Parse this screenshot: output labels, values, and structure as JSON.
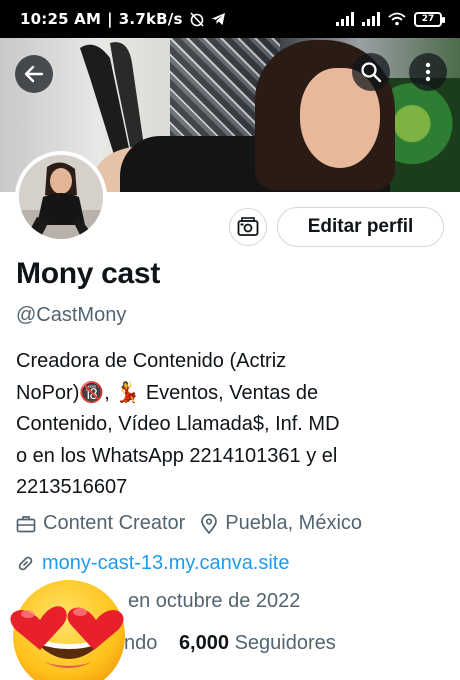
{
  "status_bar": {
    "time": "10:25 AM",
    "net_speed": "3.7kB/s",
    "battery": "27"
  },
  "header": {
    "back_icon": "back-arrow-icon",
    "search_icon": "search-icon",
    "more_icon": "more-vertical-icon"
  },
  "profile": {
    "display_name": "Mony cast",
    "handle": "@CastMony",
    "bio_lines": [
      "Creadora de Contenido (Actriz",
      "NoPor)🔞, 💃 Eventos, Ventas de",
      "Contenido,  Vídeo Llamada$, Inf. MD",
      "o en los WhatsApp  2214101361 y el",
      "2213516607"
    ],
    "category": "Content Creator",
    "location": "Puebla, México",
    "website": "mony-cast-13.my.canva.site",
    "joined": "en octubre de 2022",
    "following_partial": "ndo",
    "followers_count": "6,000",
    "followers_label": "Seguidores"
  },
  "actions": {
    "edit_profile": "Editar perfil",
    "professional_icon": "professional-tools-icon"
  },
  "colors": {
    "link": "#1d9bf0",
    "secondary_text": "#536471",
    "primary_text": "#0f1419"
  }
}
